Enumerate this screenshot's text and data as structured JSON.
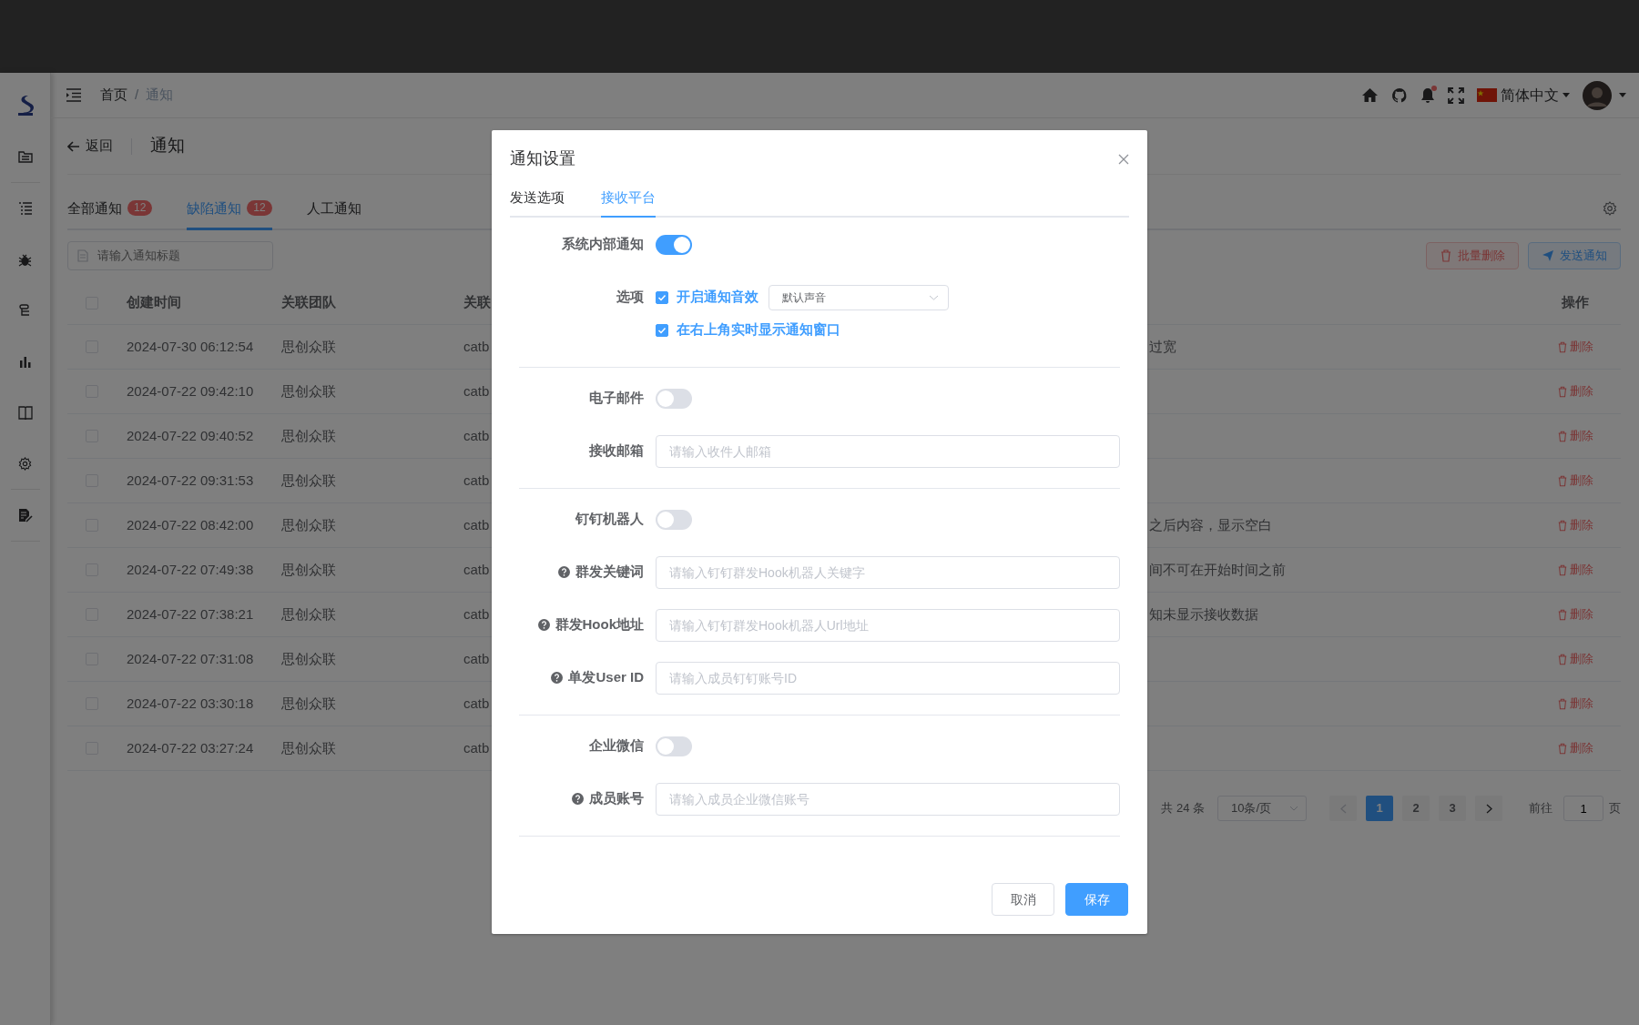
{
  "header": {
    "breadcrumb": [
      {
        "label": "首页",
        "current": false
      },
      {
        "label": "通知",
        "current": true
      }
    ],
    "breadcrumb_separator": "/",
    "notifications_dot": true,
    "language": "简体中文"
  },
  "page": {
    "back": "返回",
    "title": "通知"
  },
  "tabs": [
    {
      "label": "全部通知",
      "count": "12",
      "selected": false
    },
    {
      "label": "缺陷通知",
      "count": "12",
      "selected": true
    },
    {
      "label": "人工通知",
      "selected": false
    }
  ],
  "search": {
    "placeholder": "请输入通知标题"
  },
  "actions": [
    {
      "label": "批量删除",
      "kind": "danger"
    },
    {
      "label": "发送通知",
      "kind": "primary"
    }
  ],
  "table": {
    "select_all": {
      "checked": false
    },
    "columns": [
      "创建时间",
      "关联团队",
      "关联"
    ],
    "action_column": "操作",
    "rows": [
      {
        "checked": false,
        "created": "2024-07-30 06:12:54",
        "team": "思创众联",
        "column_3": "catb",
        "column_4": "过宽",
        "action": "删除"
      },
      {
        "checked": false,
        "created": "2024-07-22 09:42:10",
        "team": "思创众联",
        "column_3": "catb",
        "action": "删除"
      },
      {
        "checked": false,
        "created": "2024-07-22 09:40:52",
        "team": "思创众联",
        "column_3": "catb",
        "action": "删除"
      },
      {
        "checked": false,
        "created": "2024-07-22 09:31:53",
        "team": "思创众联",
        "column_3": "catb",
        "action": "删除"
      },
      {
        "checked": false,
        "created": "2024-07-22 08:42:00",
        "team": "思创众联",
        "column_3": "catb",
        "column_4": "之后内容，显示空白",
        "action": "删除"
      },
      {
        "checked": false,
        "created": "2024-07-22 07:49:38",
        "team": "思创众联",
        "column_3": "catb",
        "column_4": "间不可在开始时间之前",
        "action": "删除"
      },
      {
        "checked": false,
        "created": "2024-07-22 07:38:21",
        "team": "思创众联",
        "column_3": "catb",
        "column_4": "知未显示接收数据",
        "action": "删除"
      },
      {
        "checked": false,
        "created": "2024-07-22 07:31:08",
        "team": "思创众联",
        "column_3": "catb",
        "action": "删除"
      },
      {
        "checked": false,
        "created": "2024-07-22 03:30:18",
        "team": "思创众联",
        "column_3": "catb",
        "action": "删除"
      },
      {
        "checked": false,
        "created": "2024-07-22 03:27:24",
        "team": "思创众联",
        "column_3": "catb",
        "action": "删除"
      }
    ]
  },
  "pagination": {
    "total": "共 24 条",
    "page_size": "10条/页",
    "prev": {
      "disabled": true
    },
    "next": {
      "disabled": false
    },
    "pages": [
      {
        "label": "1",
        "selected": true
      },
      {
        "label": "2",
        "selected": false
      },
      {
        "label": "3",
        "selected": false
      }
    ],
    "goto_label": "前往",
    "goto_value": "1",
    "goto_suffix": "页"
  },
  "modal": {
    "title": "通知设置",
    "tabs": [
      {
        "label": "发送选项",
        "selected": false
      },
      {
        "label": "接收平台",
        "selected": true
      }
    ],
    "items": [
      {
        "kind": "switch",
        "label": "系统内部通知",
        "on": true
      },
      {
        "kind": "options",
        "label": "选项",
        "checks": [
          {
            "label": "开启通知音效",
            "checked": true,
            "select": "默认声音"
          },
          {
            "label": "在右上角实时显示通知窗口",
            "checked": true
          }
        ]
      },
      {
        "kind": "divider"
      },
      {
        "kind": "switch",
        "label": "电子邮件",
        "on": false
      },
      {
        "kind": "input",
        "label": "接收邮箱",
        "help": false,
        "placeholder": "请输入收件人邮箱"
      },
      {
        "kind": "divider"
      },
      {
        "kind": "switch",
        "label": "钉钉机器人",
        "on": false
      },
      {
        "kind": "input",
        "label": "群发关键词",
        "help": true,
        "placeholder": "请输入钉钉群发Hook机器人关键字"
      },
      {
        "kind": "input",
        "label": "群发Hook地址",
        "help": true,
        "placeholder": "请输入钉钉群发Hook机器人Url地址"
      },
      {
        "kind": "input",
        "label": "单发User ID",
        "help": true,
        "placeholder": "请输入成员钉钉账号ID"
      },
      {
        "kind": "divider"
      },
      {
        "kind": "switch",
        "label": "企业微信",
        "on": false
      },
      {
        "kind": "input",
        "label": "成员账号",
        "help": true,
        "placeholder": "请输入成员企业微信账号"
      },
      {
        "kind": "divider"
      }
    ],
    "buttons": [
      {
        "label": "取消",
        "kind": "default"
      },
      {
        "label": "保存",
        "kind": "primary"
      }
    ]
  }
}
